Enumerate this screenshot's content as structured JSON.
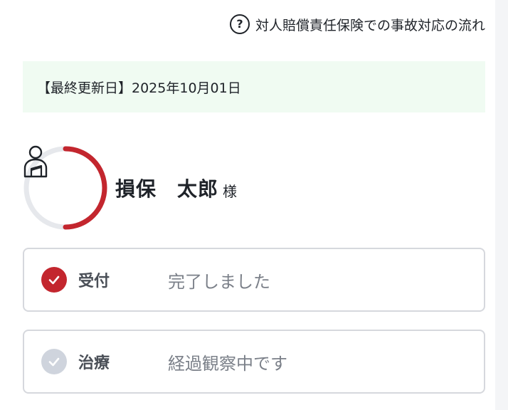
{
  "help": {
    "icon": "question-circle-icon",
    "label": "対人賠償責任保険での事故対応の流れ"
  },
  "update": {
    "text": "【最終更新日】2025年10月01日"
  },
  "profile": {
    "avatar_icon": "person-with-sling-icon",
    "name": "損保　太郎",
    "honorific": "様",
    "progress_fraction": 0.5,
    "colors": {
      "ring_done": "#c3262e",
      "ring_track": "#e6e8ec"
    }
  },
  "steps": [
    {
      "label": "受付",
      "status": "完了しました",
      "state": "done",
      "icon": "check-icon",
      "color": "#c3262e"
    },
    {
      "label": "治療",
      "status": "経過観察中です",
      "state": "pending",
      "icon": "check-icon",
      "color": "#cfd4dd"
    }
  ],
  "colors": {
    "banner_bg": "#f0fbf2",
    "card_border": "#d6d8dd"
  }
}
